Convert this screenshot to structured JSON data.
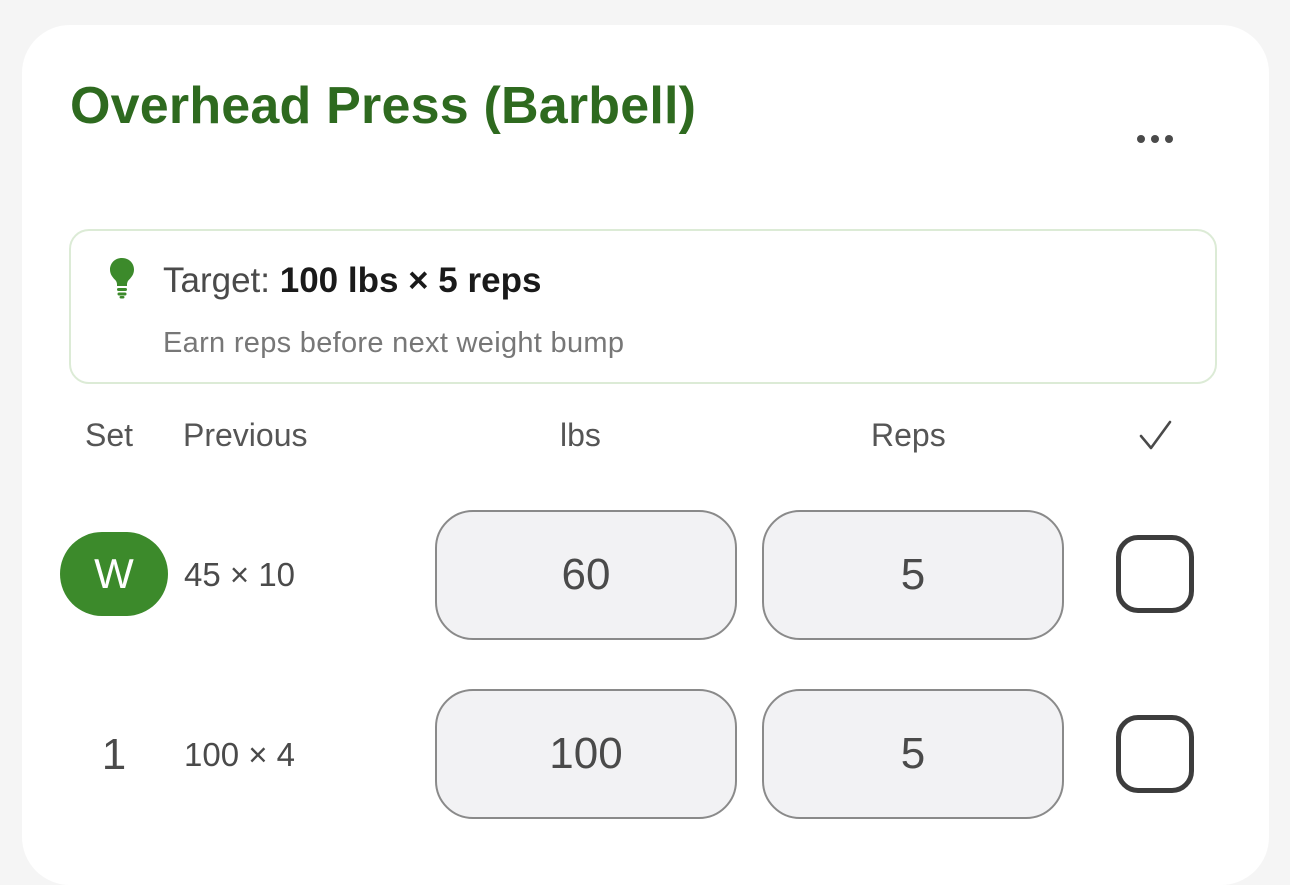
{
  "exercise": {
    "title": "Overhead Press (Barbell)",
    "more_icon": "more-horizontal-icon"
  },
  "target": {
    "icon": "lightbulb-icon",
    "label": "Target:",
    "value": "100 lbs × 5 reps",
    "subtitle": "Earn reps before next weight bump"
  },
  "table": {
    "headers": {
      "set": "Set",
      "previous": "Previous",
      "lbs": "lbs",
      "reps": "Reps",
      "done_icon": "checkmark-icon"
    },
    "rows": [
      {
        "set": "W",
        "previous": "45 × 10",
        "lbs": "60",
        "reps": "5",
        "completed": false
      },
      {
        "set": "1",
        "previous": "100 × 4",
        "lbs": "100",
        "reps": "5",
        "completed": false
      }
    ]
  },
  "colors": {
    "title_green": "#2e6a1f",
    "warmup_badge": "#3c8a2b",
    "bulb_green": "#3c8a2b",
    "target_border": "#dcebd6"
  }
}
